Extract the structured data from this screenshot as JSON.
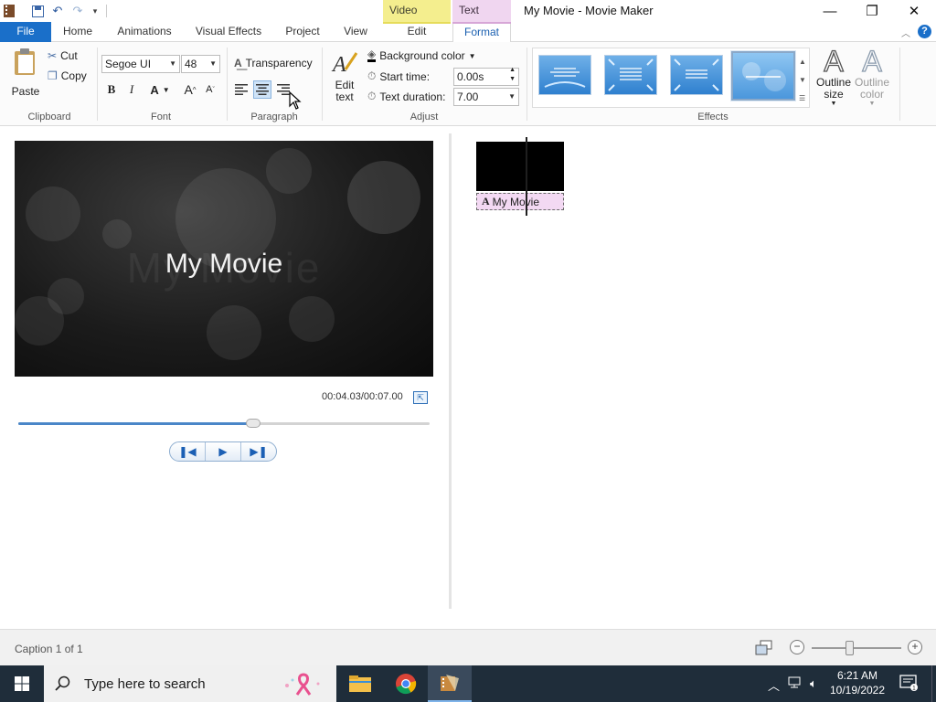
{
  "window": {
    "title": "My Movie - Movie Maker",
    "contextual_tabs": {
      "video_tools": "Video Tools",
      "text_tools": "Text Tools"
    }
  },
  "ribbon_tabs": [
    "File",
    "Home",
    "Animations",
    "Visual Effects",
    "Project",
    "View",
    "Edit",
    "Format"
  ],
  "clipboard": {
    "paste": "Paste",
    "cut": "Cut",
    "copy": "Copy",
    "label": "Clipboard"
  },
  "font": {
    "family": "Segoe UI",
    "size": "48",
    "bold": "B",
    "italic": "I",
    "color": "A",
    "grow": "A",
    "shrink": "A",
    "label": "Font"
  },
  "paragraph": {
    "transparency": "Transparency",
    "label": "Paragraph"
  },
  "adjust": {
    "edit_text": "Edit text",
    "background_color": "Background color",
    "start_time_label": "Start time:",
    "start_time_value": "0.00s",
    "text_duration_label": "Text duration:",
    "text_duration_value": "7.00",
    "label": "Adjust"
  },
  "effects": {
    "label": "Effects",
    "outline_size": "Outline size",
    "outline_color": "Outline color"
  },
  "preview": {
    "caption": "My Movie",
    "ghost_text": "My Movie",
    "timecode": "00:04.03/00:07.00",
    "progress": 0.57
  },
  "storyboard": {
    "caption_strip": "My Movie"
  },
  "status": {
    "text": "Caption 1 of 1",
    "zoom_level": 0.42
  },
  "taskbar": {
    "search_placeholder": "Type here to search",
    "time": "6:21 AM",
    "date": "10/19/2022"
  },
  "colors": {
    "accent": "#1a6fc9",
    "video_tools": "#f4ee8e",
    "text_tools": "#f0d6f0",
    "taskbar": "#1f2d3a"
  }
}
